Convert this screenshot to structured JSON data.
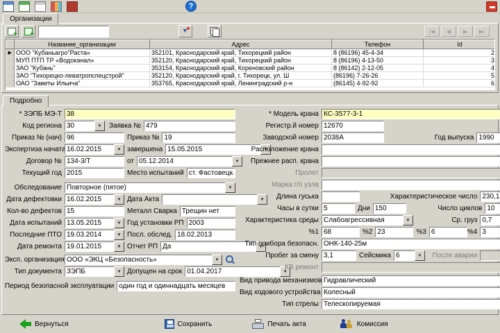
{
  "top_toolbar": {
    "icons": [
      "table-icon",
      "add-table-icon",
      "print-icon",
      "abacus-icon",
      "book-icon",
      "help-icon",
      "exit-icon"
    ]
  },
  "org": {
    "tab_label": "Организации",
    "toolbar": {
      "search_value": "",
      "icons": [
        "add-row-icon",
        "insert-row-icon",
        "filter-icon",
        "copy-icon"
      ],
      "nav": {
        "first": "|◀",
        "prev": "◀",
        "next": "▶",
        "last": "▶|"
      }
    },
    "grid": {
      "columns": {
        "name": "Название_организации",
        "address": "Адрес",
        "phone": "Телефон",
        "id": "Id"
      },
      "rows": [
        {
          "name": "ООО \"Кубаньагро\"Раста»",
          "address": "352101, Краснодарский край, Тихорецкий район",
          "phone": "8 (86196) 45-4-34",
          "id": "2"
        },
        {
          "name": "МУП ПТП ТР «Водоканал»",
          "address": "352120, Краснодарский край, Тихорецкий район",
          "phone": "8 (86196) 4-13-50",
          "id": "3"
        },
        {
          "name": "ЗАО \"Кубань\"",
          "address": "353154, Краснодарский край, Кореновский район",
          "phone": "8 (86142) 2-12-05",
          "id": "4"
        },
        {
          "name": "ЗАО \"Тихорецко-леватропспецстрой\"",
          "address": "352120, Краснодарский край, г. Тихорецк, ул. Ш",
          "phone": "(86196) 7-26-26",
          "id": "5"
        },
        {
          "name": "ОАО \"Заветы Ильича\"",
          "address": "353765, Краснодарский край, Ленинградский р-н",
          "phone": "(86145) 4-92-92",
          "id": "6"
        }
      ]
    }
  },
  "details": {
    "tab_label": "Подробно",
    "f": {
      "zepb": {
        "l": "* ЗЭПБ МЭ-Т",
        "v": "38"
      },
      "region": {
        "l": "Код региона",
        "v": "30"
      },
      "zayavka": {
        "l": "Заявка №",
        "v": "479"
      },
      "prikaz_n": {
        "l": "Приказ № (нач)",
        "v": "96"
      },
      "prikaz": {
        "l": "Приказ №",
        "v": "19"
      },
      "exp_start": {
        "l": "Экспертиза начата",
        "v": "16.02.2015"
      },
      "exp_end": {
        "l": "завершена",
        "v": "15.05.2015"
      },
      "dogovor": {
        "l": "Договор №",
        "v": "134-3/Т"
      },
      "dogovor_ot": {
        "l": "от",
        "v": "05.12.2014"
      },
      "tek_god": {
        "l": "Текущий год",
        "v": "2015"
      },
      "mesto": {
        "l": "Место испытаний",
        "v": "ст. Фастовецкая"
      },
      "obsled": {
        "l": "Обследование",
        "v": "Повторное (пятое)"
      },
      "data_def": {
        "l": "Дата дефектовки",
        "v": "16.02.2015"
      },
      "data_akta": {
        "l": "Дата Акта",
        "v": ""
      },
      "kol_def": {
        "l": "Кол-во дефектов",
        "v": "15"
      },
      "metall": {
        "l": "Металл Сварка",
        "v": "Трещин нет"
      },
      "data_isp": {
        "l": "Дата испытаний",
        "v": "13.05.2015"
      },
      "god_rp": {
        "l": "Год установки РП",
        "v": "2003"
      },
      "posl_pto": {
        "l": "Последние ПТО",
        "v": "19.03.2014"
      },
      "posl_obsl": {
        "l": "Посл. обслед.",
        "v": "18.02.2013"
      },
      "data_rem": {
        "l": "Дата ремонта",
        "v": "19.01.2015"
      },
      "otchet_rp": {
        "l": "Отчет РП",
        "v": "Да"
      },
      "exp_org": {
        "l": "Эксп. организация",
        "v": "ООО «ЭКЦ «Безопасность»"
      },
      "tip_dok": {
        "l": "Тип документа",
        "v": "ЗЭПБ"
      },
      "dopusk": {
        "l": "Допущен на срок",
        "v": "01.04.2017"
      },
      "period": {
        "l": "Период безопасной эксплуатации",
        "v": "один год и одиннадцать месяцев"
      },
      "model": {
        "l": "* Модель крана",
        "v": "КС-3577-3-1"
      },
      "reg_nom": {
        "l": "Регистр.й номер",
        "v": "12670"
      },
      "zav_nom": {
        "l": "Заводской номер",
        "v": "2038А"
      },
      "god_vyp": {
        "l": "Год выпуска",
        "v": "1990"
      },
      "raspol": {
        "l": "Расположение крана",
        "v": ""
      },
      "prezh": {
        "l": "Прежнее расп. крана",
        "v": ""
      },
      "prolet": {
        "l": "Пролет",
        "v": ""
      },
      "marka_uzla": {
        "l": "Марка г/п узла",
        "v": ""
      },
      "dlina_guska": {
        "l": "Длина гуська",
        "v": ""
      },
      "har_chislo": {
        "l": "Характеристическое число",
        "v": "230,1"
      },
      "chasy": {
        "l": "Часы в сутки",
        "v": "5"
      },
      "dni": {
        "l": "Дни",
        "v": "150"
      },
      "cikly": {
        "l": "Число циклов",
        "v": "10"
      },
      "har_sredy": {
        "l": "Характеристика среды",
        "v": "Слабоагрессивная"
      },
      "sr_gruz": {
        "l": "Ср. груз",
        "v": "0,7"
      },
      "p1": {
        "l": "%1",
        "v": "68"
      },
      "p2": {
        "l": "%2",
        "v": "23"
      },
      "p3": {
        "l": "%3",
        "v": "6"
      },
      "p4": {
        "l": "%4",
        "v": "3"
      },
      "pribor": {
        "l": "Тип прибора безопасн.",
        "v": "ОНК-140-25м"
      },
      "probeg": {
        "l": "Пробег за смену",
        "v": "3,1"
      },
      "seismika": {
        "l": "Сейсмика",
        "v": "6"
      },
      "posle_avarii": {
        "l": "После аварии",
        "v": ""
      },
      "kv_remont": {
        "l": "КВ ремонт",
        "v": ""
      },
      "privod": {
        "l": "Вид привода механизмов",
        "v": "Гидравлический"
      },
      "hodovoe": {
        "l": "Вид ходового устройства",
        "v": "Колесный"
      },
      "strela": {
        "l": "Тип стрелы",
        "v": "Телескопируемая"
      }
    }
  },
  "footer": {
    "back": "Вернуться",
    "save": "Сохранить",
    "print": "Печать акта",
    "commission": "Комиссия",
    "icons": [
      "back-arrow-icon",
      "save-icon",
      "print-icon",
      "commission-people-icon"
    ]
  }
}
